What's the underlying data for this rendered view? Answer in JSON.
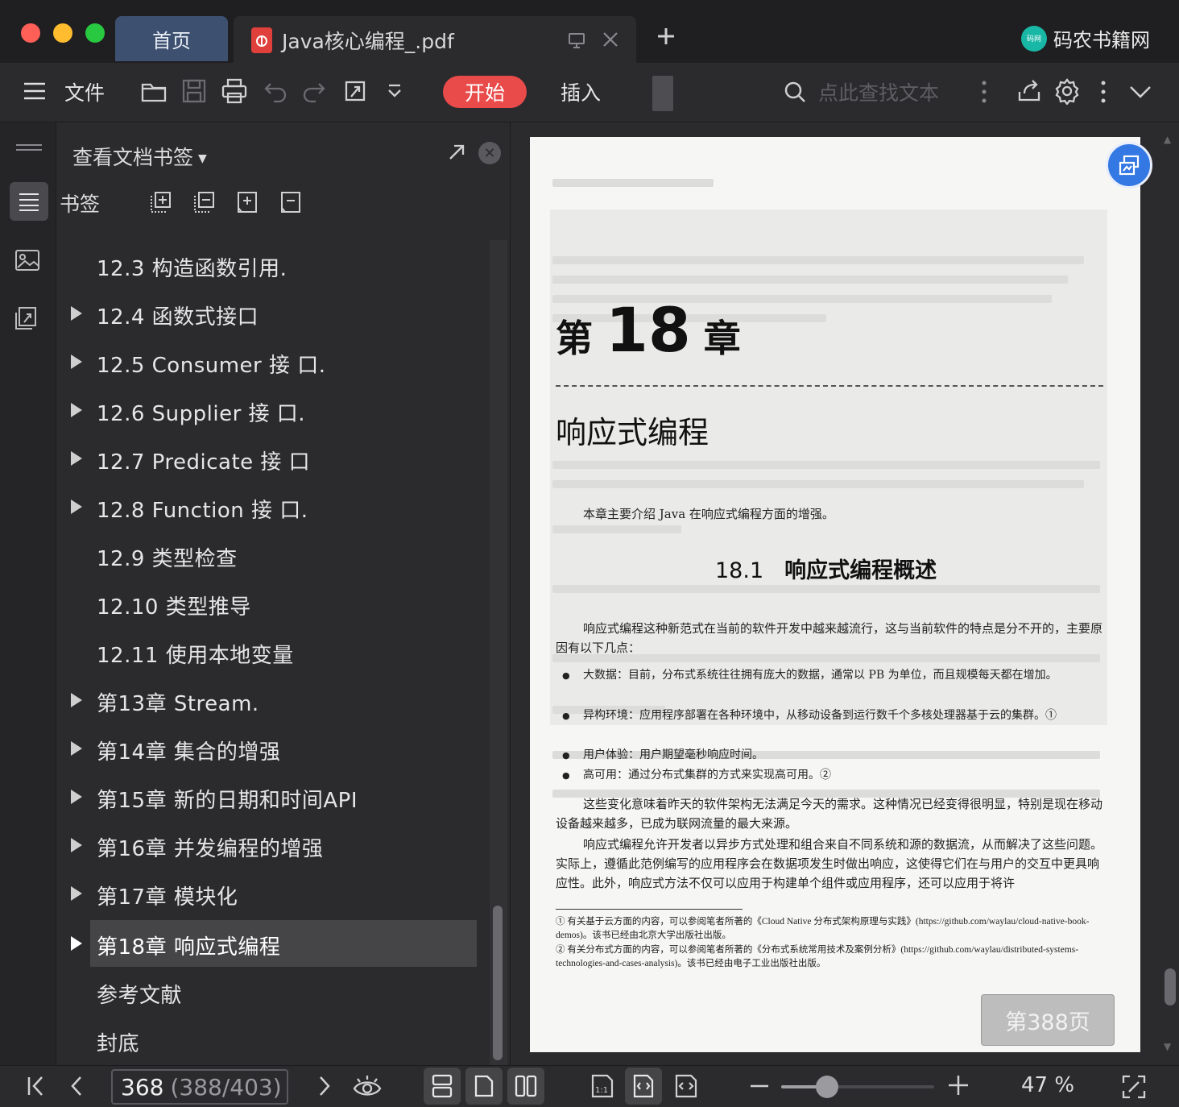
{
  "colors": {
    "accent": "#e94a4a",
    "brand_logo": "#19b7a6",
    "float_button": "#3478e4",
    "home_tab": "#3d5070"
  },
  "tabs": {
    "home_label": "首页",
    "doc_title": "Java核心编程_.pdf"
  },
  "brand": {
    "name": "码农书籍网",
    "logo_text": "码网"
  },
  "toolbar": {
    "menu_label": "文件",
    "start_label": "开始",
    "insert_label": "插入",
    "search_placeholder": "点此查找文本"
  },
  "panel": {
    "title": "查看文档书签",
    "bookmarks_label": "书签",
    "items": [
      {
        "label": "12.3 构造函数引用.",
        "expandable": false
      },
      {
        "label": "12.4 函数式接口",
        "expandable": true
      },
      {
        "label": "12.5 Consumer 接 口.",
        "expandable": true
      },
      {
        "label": "12.6 Supplier 接 口.",
        "expandable": true
      },
      {
        "label": "12.7 Predicate 接 口",
        "expandable": true
      },
      {
        "label": "12.8 Function 接 口.",
        "expandable": true
      },
      {
        "label": "12.9 类型检查",
        "expandable": false
      },
      {
        "label": "12.10 类型推导",
        "expandable": false
      },
      {
        "label": "12.11 使用本地变量",
        "expandable": false
      },
      {
        "label": "第13章 Stream.",
        "expandable": true
      },
      {
        "label": "第14章 集合的增强",
        "expandable": true
      },
      {
        "label": "第15章 新的日期和时间API",
        "expandable": true
      },
      {
        "label": "第16章 并发编程的增强",
        "expandable": true
      },
      {
        "label": "第17章 模块化",
        "expandable": true
      },
      {
        "label": "第18章 响应式编程",
        "expandable": true,
        "selected": true
      },
      {
        "label": "参考文献",
        "expandable": false
      },
      {
        "label": "封底",
        "expandable": false
      }
    ]
  },
  "page": {
    "chapter_prefix": "第",
    "chapter_number": "18",
    "chapter_suffix": "章",
    "chapter_title": "响应式编程",
    "intro": "本章主要介绍 Java 在响应式编程方面的增强。",
    "section_number": "18.1",
    "section_title": "响应式编程概述",
    "para1": "响应式编程这种新范式在当前的软件开发中越来越流行，这与当前软件的特点是分不开的，主要原因有以下几点：",
    "bullets": [
      "大数据：目前，分布式系统往往拥有庞大的数据，通常以 PB 为单位，而且规模每天都在增加。",
      "异构环境：应用程序部署在各种环境中，从移动设备到运行数千个多核处理器基于云的集群。①",
      "用户体验：用户期望毫秒响应时间。",
      "高可用：通过分布式集群的方式来实现高可用。②"
    ],
    "para2": "这些变化意味着昨天的软件架构无法满足今天的需求。这种情况已经变得很明显，特别是现在移动设备越来越多，已成为联网流量的最大来源。",
    "para3": "响应式编程允许开发者以异步方式处理和组合来自不同系统和源的数据流，从而解决了这些问题。实际上，遵循此范例编写的应用程序会在数据项发生时做出响应，这使得它们在与用户的交互中更具响应性。此外，响应式方法不仅可以应用于构建单个组件或应用程序，还可以应用于将许",
    "footnote1": "① 有关基于云方面的内容，可以参阅笔者所著的《Cloud Native 分布式架构原理与实践》(https://github.com/waylau/cloud-native-book-demos)。该书已经由北京大学出版社出版。",
    "footnote2": "② 有关分布式方面的内容，可以参阅笔者所著的《分布式系统常用技术及案例分析》(https://github.com/waylau/distributed-systems-technologies-and-cases-analysis)。该书已经由电子工业出版社出版。",
    "page_badge": "第388页"
  },
  "status": {
    "page_number": "368",
    "page_detail": "(388/403)",
    "zoom_fraction": 0.3,
    "zoom": "47 %"
  }
}
